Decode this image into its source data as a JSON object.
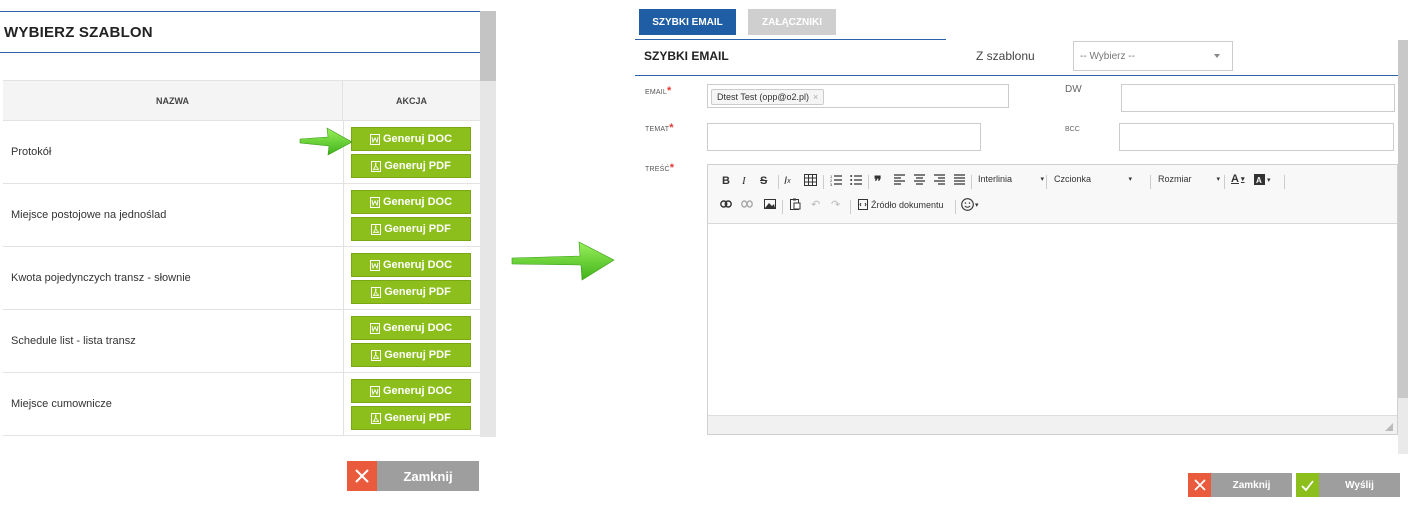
{
  "left": {
    "title": "WYBIERZ SZABLON",
    "columns": {
      "name": "NAZWA",
      "action": "AKCJA"
    },
    "rows": [
      {
        "name": "Protokół"
      },
      {
        "name": "Miejsce postojowe na jednoślad"
      },
      {
        "name": "Kwota pojedynczych transz - słownie"
      },
      {
        "name": "Schedule list - lista transz"
      },
      {
        "name": "Miejsce cumownicze"
      }
    ],
    "btn_doc": "Generuj DOC",
    "btn_pdf": "Generuj PDF",
    "close_label": "Zamknij"
  },
  "right": {
    "tabs": [
      {
        "label": "SZYBKI EMAIL",
        "active": true
      },
      {
        "label": "ZAŁĄCZNIKI",
        "active": false
      }
    ],
    "form_title": "SZYBKI EMAIL",
    "template_label": "Z szablonu",
    "template_select": "-- Wybierz --",
    "email_label": "EMAIL",
    "email_tag": "Dtest Test (opp@o2.pl)",
    "dw_label": "DW",
    "temat_label": "TEMAT",
    "bcc_label": "BCC",
    "tresc_label": "TREŚĆ",
    "required_mark": "*",
    "toolbar": {
      "interlinia": "Interlinia",
      "czcionka": "Czcionka",
      "rozmiar": "Rozmiar",
      "source": "Źródło dokumentu"
    },
    "close_label": "Zamknij",
    "send_label": "Wyślij"
  },
  "colors": {
    "accent_blue": "#1f5da4",
    "green": "#8cbf1c",
    "red": "#ea5a3c",
    "grey_button": "#9e9e9e"
  }
}
